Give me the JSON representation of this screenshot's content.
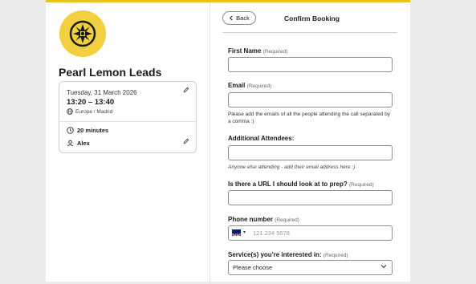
{
  "brand": {
    "accent": "#e8c21f",
    "logo_color": "#f2cf3f"
  },
  "organizer": {
    "name": "Pearl Lemon Leads",
    "date": "Tuesday, 31 March 2026",
    "time": "13:20 – 13:40",
    "timezone": "Europe / Madrid",
    "duration": "20 minutes",
    "host": "Alex"
  },
  "header": {
    "back_label": "Back",
    "title": "Confirm Booking"
  },
  "form": {
    "first_name": {
      "label": "First Name",
      "required": "(Required)"
    },
    "email": {
      "label": "Email",
      "required": "(Required)",
      "help": "Please add the emails of all the people attending the call separated by a comma :)"
    },
    "attendees": {
      "label": "Additional Attendees:",
      "help": "Anyone else attending - add their email address here :)"
    },
    "url": {
      "label": "Is there a URL I should look at to prep?",
      "required": "(Required)"
    },
    "phone": {
      "label": "Phone number",
      "required": "(Required)",
      "placeholder": "121 234 5678",
      "country": "gb-flag"
    },
    "services": {
      "label": "Service(s) you're interested in:",
      "required": "(Required)",
      "selected": "Please choose"
    }
  },
  "icons": {
    "edit": "pencil-icon",
    "globe": "globe-icon",
    "clock": "clock-icon",
    "user": "user-icon",
    "back": "chevron-left-icon",
    "select": "chevron-down-icon"
  }
}
